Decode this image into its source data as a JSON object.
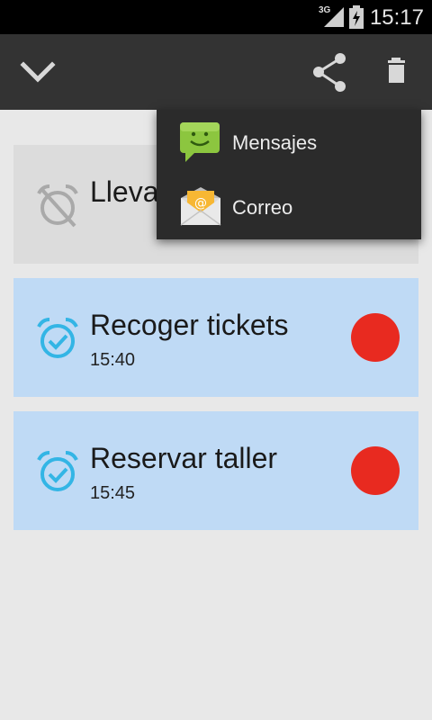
{
  "status_bar": {
    "network": "3G",
    "clock": "15:17",
    "icons": [
      "signal-icon",
      "battery-charging-icon"
    ]
  },
  "action_bar": {
    "icons": [
      "checkmark-chevron-icon",
      "share-icon",
      "trash-icon"
    ]
  },
  "share_menu": {
    "items": [
      {
        "label": "Mensajes",
        "icon": "messaging-app-icon"
      },
      {
        "label": "Correo",
        "icon": "email-app-icon"
      }
    ]
  },
  "reminders": [
    {
      "title": "Llevar",
      "time": "",
      "active": false,
      "icon": "alarm-off-icon"
    },
    {
      "title": "Recoger tickets",
      "time": "15:40",
      "active": true,
      "icon": "alarm-check-icon",
      "color": "#e82a20"
    },
    {
      "title": "Reservar taller",
      "time": "15:45",
      "active": true,
      "icon": "alarm-check-icon",
      "color": "#e82a20"
    }
  ],
  "colors": {
    "action_bar": "#333333",
    "active_card": "#bfdaf5",
    "inactive_card": "#dcdcdc",
    "accent_icon": "#33b5e5",
    "dot": "#e82a20"
  }
}
